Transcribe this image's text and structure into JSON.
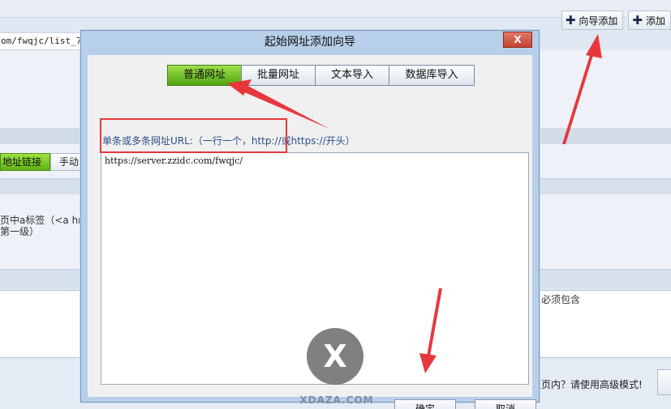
{
  "background": {
    "top_buttons": [
      {
        "label": "向导添加",
        "icon": "plus-icon"
      },
      {
        "label": "添加",
        "icon": "plus-icon"
      }
    ],
    "url_fragment": "om/fwqjc/list_7_",
    "tabs": {
      "active_label": "地址链接",
      "other_label": "手动"
    },
    "note_text": "页中a标签（<a hr\n第一级）",
    "must_contain_text": "必须包含",
    "advanced_text": "表页内？请使用高级模式!"
  },
  "dialog": {
    "title": "起始网址添加向导",
    "close_label": "X",
    "tabs": [
      {
        "label": "普通网址",
        "active": true
      },
      {
        "label": "批量网址",
        "active": false
      },
      {
        "label": "文本导入",
        "active": false
      },
      {
        "label": "数据库导入",
        "active": false
      }
    ],
    "url_label": "单条或多条网址URL:（一行一个，http://或https://开头）",
    "url_value": "https://server.zzidc.com/fwqjc/",
    "ok_label": "确定",
    "cancel_label": "取消"
  },
  "annotations": {
    "highlight_color": "#e8373c",
    "arrow_color": "#e8373c"
  },
  "watermark": {
    "glyph": "X",
    "text": "XDAZA.COM"
  }
}
